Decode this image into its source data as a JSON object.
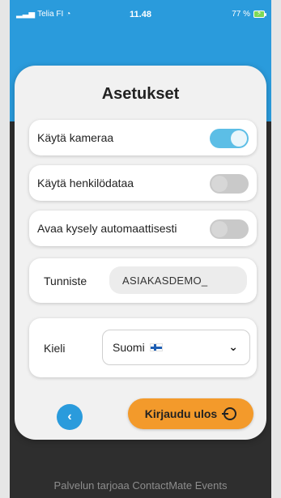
{
  "status_bar": {
    "carrier": "Telia FI",
    "time": "11.48",
    "battery": "77 %",
    "battery_color": "#7ed957"
  },
  "settings": {
    "title": "Asetukset",
    "toggles": [
      {
        "label": "Käytä kameraa",
        "on": true
      },
      {
        "label": "Käytä henkilödataa",
        "on": false
      },
      {
        "label": "Avaa kysely automaattisesti",
        "on": false
      }
    ],
    "identifier": {
      "label": "Tunniste",
      "value": "ASIAKASDEMO_"
    },
    "language": {
      "label": "Kieli",
      "selected": "Suomi"
    }
  },
  "buttons": {
    "back_label": "‹",
    "logout_label": "Kirjaudu ulos"
  },
  "footer": {
    "text": "Palvelun tarjoaa ContactMate Events"
  },
  "colors": {
    "accent_blue": "#2a9bdc",
    "toggle_on": "#5cbee6",
    "logout": "#f39a2b"
  }
}
